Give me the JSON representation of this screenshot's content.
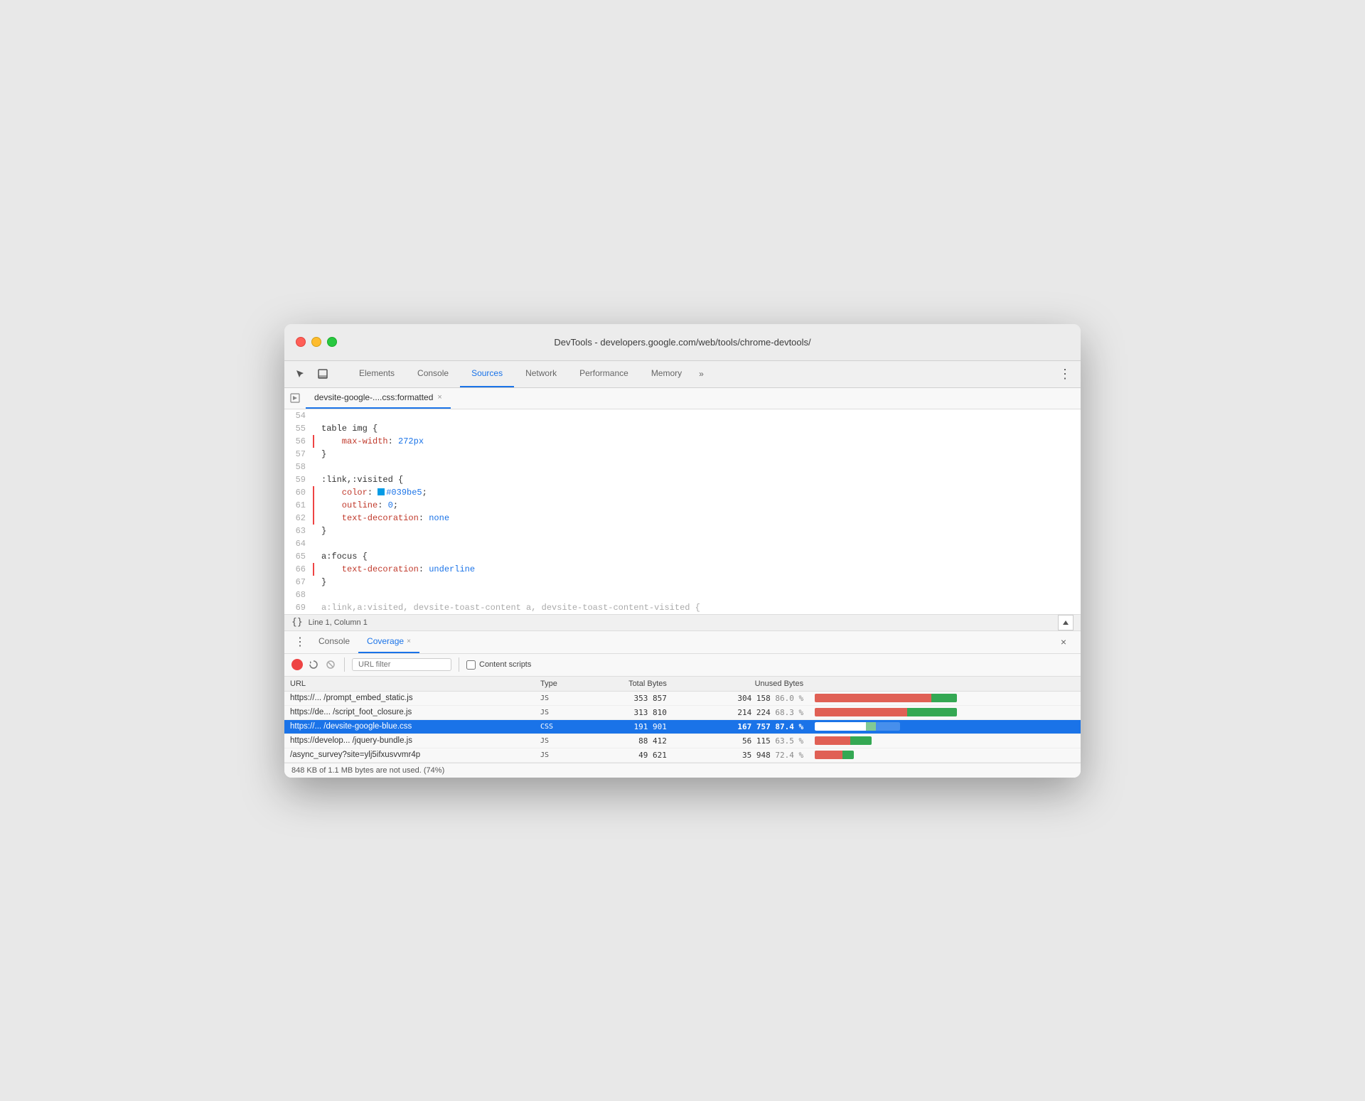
{
  "window": {
    "title": "DevTools - developers.google.com/web/tools/chrome-devtools/"
  },
  "tabs": [
    {
      "label": "Elements",
      "active": false
    },
    {
      "label": "Console",
      "active": false
    },
    {
      "label": "Sources",
      "active": true
    },
    {
      "label": "Network",
      "active": false
    },
    {
      "label": "Performance",
      "active": false
    },
    {
      "label": "Memory",
      "active": false
    }
  ],
  "filetab": {
    "name": "devsite-google-....css:formatted",
    "close": "×"
  },
  "code": {
    "lines": [
      {
        "num": "54",
        "content": "",
        "highlighted": false
      },
      {
        "num": "55",
        "type": "selector",
        "content": "table img {",
        "highlighted": false
      },
      {
        "num": "56",
        "type": "prop",
        "prop": "    max-width",
        "val": " 272px",
        "valClass": "val-blue",
        "highlighted": true
      },
      {
        "num": "57",
        "content": "}",
        "highlighted": false
      },
      {
        "num": "58",
        "content": "",
        "highlighted": false
      },
      {
        "num": "59",
        "type": "selector",
        "content": ":link,:visited {",
        "highlighted": false
      },
      {
        "num": "60",
        "type": "prop-color",
        "prop": "    color",
        "swatch": "#039be5",
        "val": "#039be5",
        "semi": ";",
        "highlighted": true
      },
      {
        "num": "61",
        "type": "prop",
        "prop": "    outline",
        "val": " 0",
        "valClass": "val-blue",
        "highlighted": true
      },
      {
        "num": "62",
        "type": "prop",
        "prop": "    text-decoration",
        "val": " none",
        "valClass": "val-blue",
        "highlighted": true
      },
      {
        "num": "63",
        "content": "}",
        "highlighted": false
      },
      {
        "num": "64",
        "content": "",
        "highlighted": false
      },
      {
        "num": "65",
        "type": "selector",
        "content": "a:focus {",
        "highlighted": false
      },
      {
        "num": "66",
        "type": "prop",
        "prop": "    text-decoration",
        "val": " underline",
        "valClass": "val-blue",
        "highlighted": true
      },
      {
        "num": "67",
        "content": "}",
        "highlighted": false
      },
      {
        "num": "68",
        "content": "",
        "highlighted": false
      },
      {
        "num": "69",
        "type": "truncated",
        "content": "a:link,a:visited, devsite-toast-content a, devsite-toast-content-visited {",
        "highlighted": false
      }
    ]
  },
  "statusbar": {
    "icon": "{}",
    "text": "Line 1, Column 1"
  },
  "bottomPanel": {
    "tabs": [
      {
        "label": "Console",
        "active": false,
        "closeable": false
      },
      {
        "label": "Coverage",
        "active": true,
        "closeable": true
      }
    ]
  },
  "coverageToolbar": {
    "urlFilterPlaceholder": "URL filter",
    "contentScriptsLabel": "Content scripts"
  },
  "coverageTable": {
    "headers": [
      "URL",
      "Type",
      "Total Bytes",
      "Unused Bytes",
      ""
    ],
    "rows": [
      {
        "url": "https://... /prompt_embed_static.js",
        "type": "JS",
        "totalBytes": "353 857",
        "unusedBytes": "304 158",
        "unusedPercent": "86.0 %",
        "selected": false,
        "barUnusedWidth": 82,
        "barUsedWidth": 18
      },
      {
        "url": "https://de... /script_foot_closure.js",
        "type": "JS",
        "totalBytes": "313 810",
        "unusedBytes": "214 224",
        "unusedPercent": "68.3 %",
        "selected": false,
        "barUnusedWidth": 65,
        "barUsedWidth": 35
      },
      {
        "url": "https://... /devsite-google-blue.css",
        "type": "CSS",
        "totalBytes": "191 901",
        "unusedBytes": "167 757",
        "unusedPercent": "87.4 %",
        "selected": true,
        "barUnusedWidth": 60,
        "barUsedWidth": 12
      },
      {
        "url": "https://develop... /jquery-bundle.js",
        "type": "JS",
        "totalBytes": "88 412",
        "unusedBytes": "56 115",
        "unusedPercent": "63.5 %",
        "selected": false,
        "barUnusedWidth": 25,
        "barUsedWidth": 15
      },
      {
        "url": "/async_survey?site=ylj5ifxusvvmr4p",
        "type": "JS",
        "totalBytes": "49 621",
        "unusedBytes": "35 948",
        "unusedPercent": "72.4 %",
        "selected": false,
        "barUnusedWidth": 16,
        "barUsedWidth": 7
      }
    ]
  },
  "footer": {
    "text": "848 KB of 1.1 MB bytes are not used. (74%)"
  }
}
